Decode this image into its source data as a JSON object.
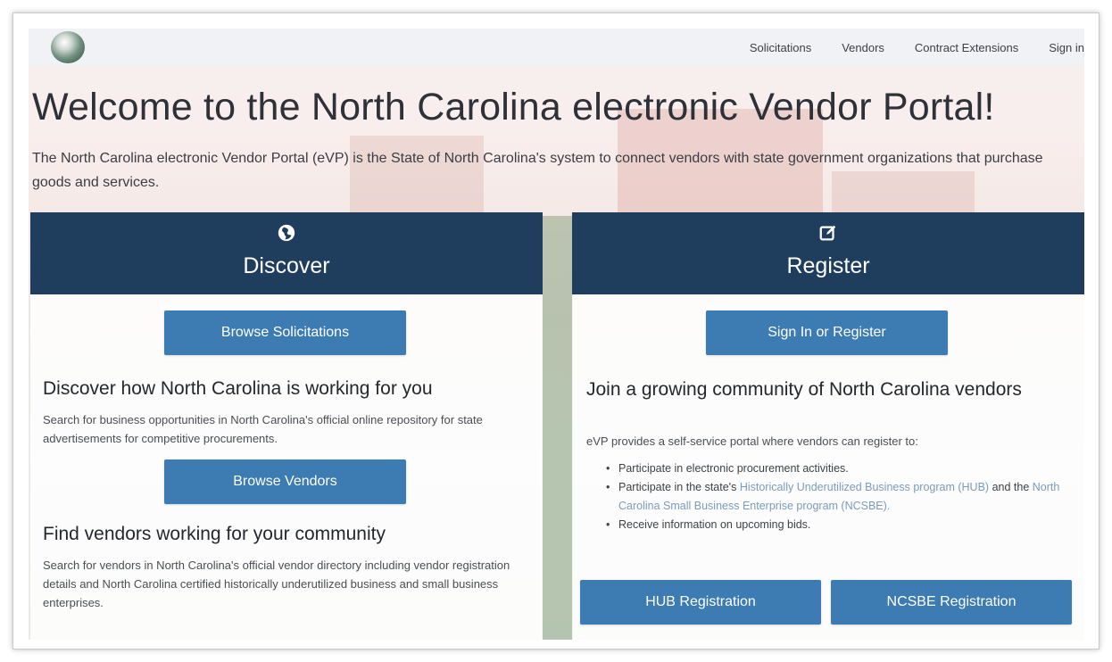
{
  "nav": {
    "links": [
      "Solicitations",
      "Vendors",
      "Contract Extensions",
      "Sign in"
    ]
  },
  "hero": {
    "title": "Welcome to the North Carolina electronic Vendor Portal!",
    "description": "The North Carolina electronic Vendor Portal (eVP) is the State of North Carolina's system to connect vendors with state government organizations that purchase goods and services."
  },
  "discover": {
    "title": "Discover",
    "icon": "globe-icon",
    "browse_solicitations": "Browse Solicitations",
    "section1_heading": "Discover how North Carolina is working for you",
    "section1_text": "Search for business opportunities in North Carolina's official online repository for state advertisements for competitive procurements.",
    "browse_vendors": "Browse Vendors",
    "section2_heading": "Find vendors working for your community",
    "section2_text": "Search for vendors in North Carolina's official vendor directory including vendor registration details and North Carolina certified historically underutilized business and small business enterprises."
  },
  "register": {
    "title": "Register",
    "icon": "edit-icon",
    "signin_register": "Sign In or Register",
    "heading": "Join a growing community of North Carolina vendors",
    "intro": "eVP provides a self-service portal where vendors can register to:",
    "bullet1": "Participate in electronic procurement activities.",
    "bullet2_prefix": "Participate in the state's",
    "bullet2_link1": "Historically Underutilized Business program (HUB)",
    "bullet2_mid": "and the",
    "bullet2_link2": "North Carolina Small Business Enterprise program (NCSBE).",
    "bullet3": "Receive information on upcoming bids.",
    "hub_button": "HUB Registration",
    "ncsbe_button": "NCSBE Registration"
  },
  "colors": {
    "header_navy": "#1f3d5c",
    "button_blue": "#3d7cb3",
    "link_blue": "#7a9cbc"
  }
}
